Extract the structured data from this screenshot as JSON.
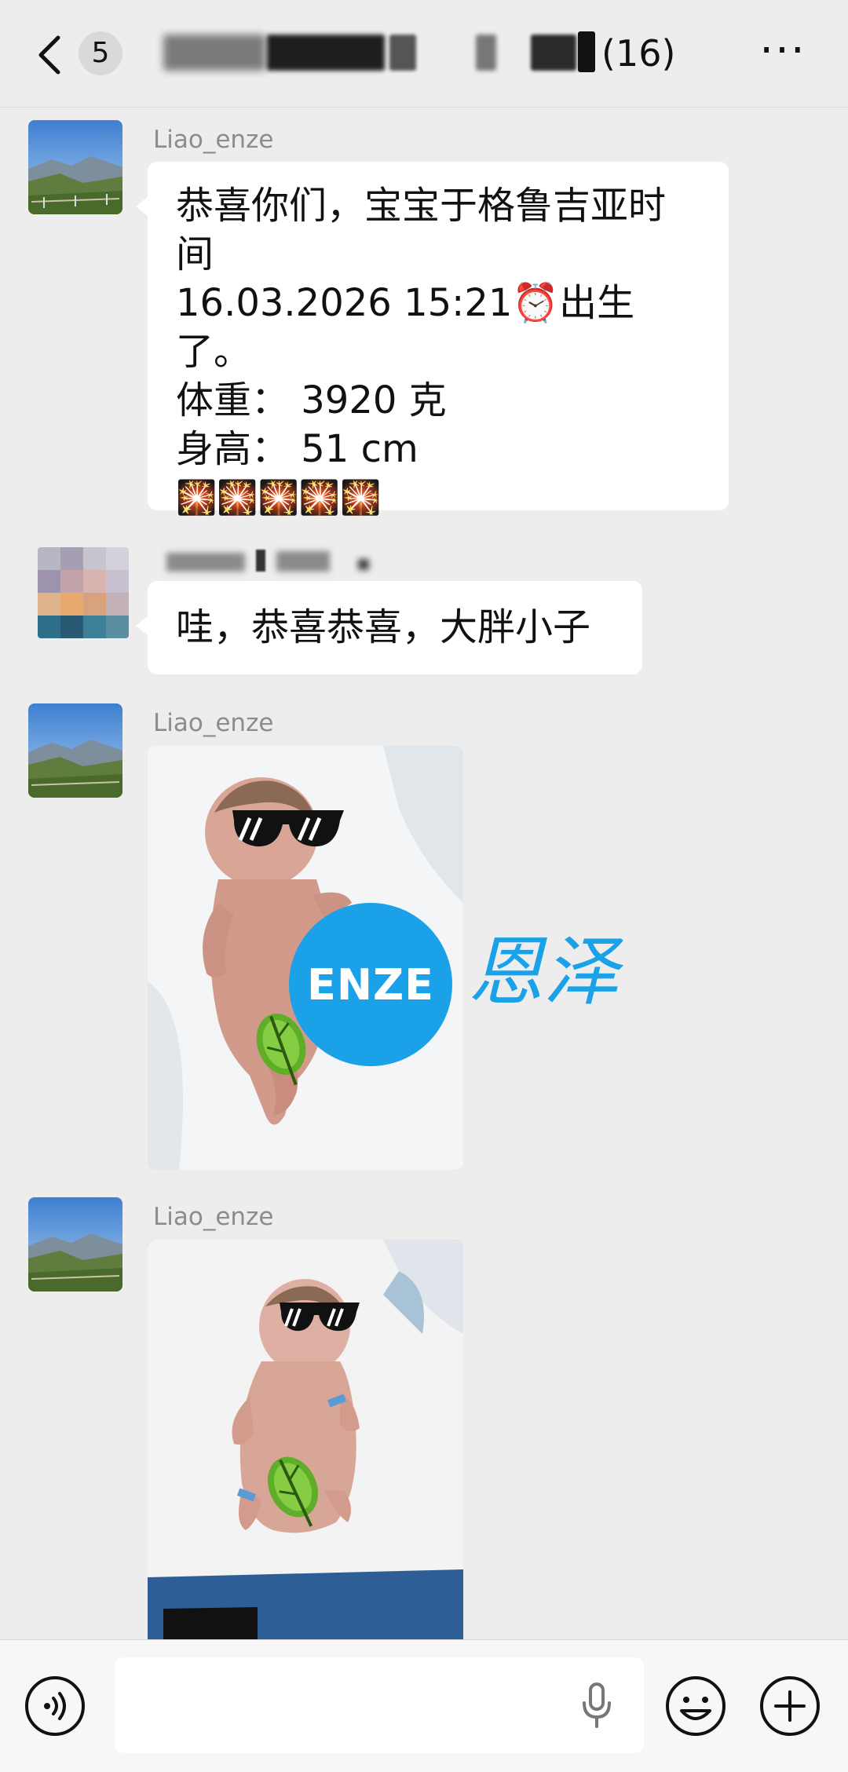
{
  "header": {
    "unread_count": "5",
    "member_count": "(16)",
    "more_label": "···"
  },
  "messages": [
    {
      "sender": "Liao_enze",
      "lines": [
        "恭喜你们，宝宝于格鲁吉亚时",
        "间",
        "16.03.2026  15:21⏰出生了。",
        "体重： 3920 克",
        "身高：  51 cm",
        "🎇🎇🎇🎇🎇"
      ]
    },
    {
      "sender": "",
      "text": "哇，恭喜恭喜，大胖小子"
    },
    {
      "sender": "Liao_enze",
      "image": "newborn-photo-1",
      "overlay_logo": "ENZE",
      "overlay_caption": "恩泽"
    },
    {
      "sender": "Liao_enze",
      "image": "newborn-photo-2"
    }
  ],
  "icons": {
    "back": "chevron-left-icon",
    "voice": "voice-icon",
    "mic": "microphone-icon",
    "emoji": "emoji-icon",
    "plus": "plus-icon"
  },
  "colors": {
    "background": "#ededed",
    "bubble": "#ffffff",
    "name": "#8c8c8c",
    "logo_blue": "#1ba1e8"
  }
}
